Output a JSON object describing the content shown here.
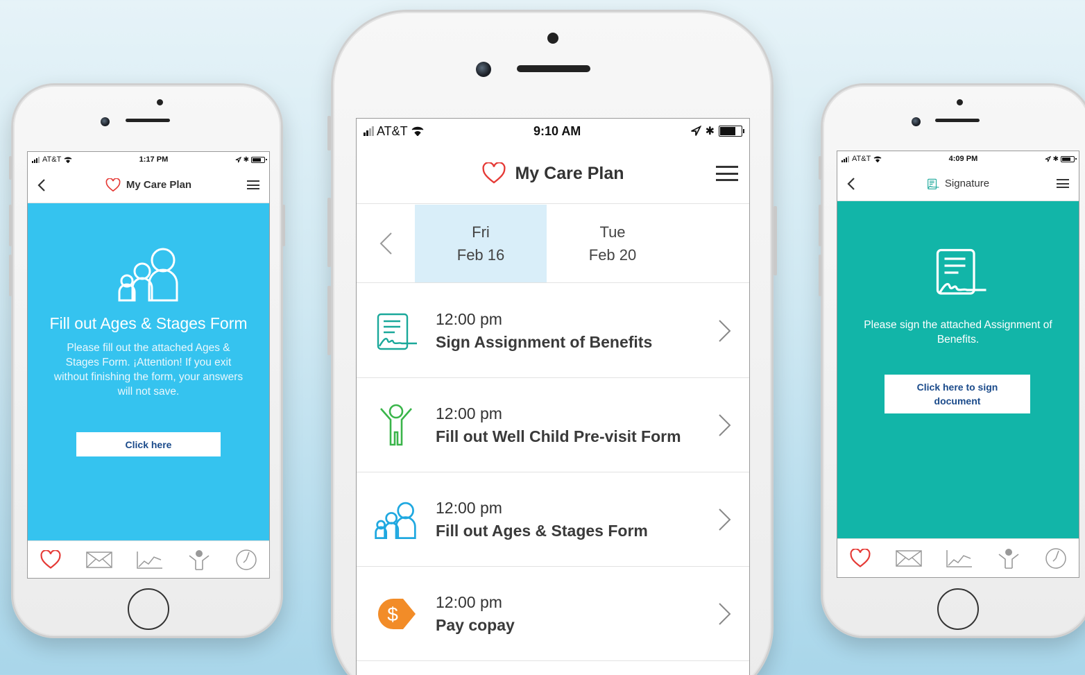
{
  "left_phone": {
    "status": {
      "carrier": "AT&T",
      "time": "1:17 PM"
    },
    "nav": {
      "title": "My Care Plan"
    },
    "content": {
      "heading": "Fill out Ages & Stages Form",
      "body": "Please fill out the attached Ages & Stages Form. ¡Attention! If you exit without finishing the form, your answers will not save.",
      "button": "Click here"
    },
    "tabs": [
      "heart-icon",
      "mail-icon",
      "chart-icon",
      "child-icon",
      "clock-icon"
    ]
  },
  "center_phone": {
    "status": {
      "carrier": "AT&T",
      "time": "9:10 AM"
    },
    "nav": {
      "title": "My Care Plan"
    },
    "dates": [
      {
        "weekday": "Fri",
        "date": "Feb 16",
        "selected": true
      },
      {
        "weekday": "Tue",
        "date": "Feb 20",
        "selected": false
      }
    ],
    "tasks": [
      {
        "time": "12:00 pm",
        "title": "Sign Assignment of Benefits",
        "icon": "signature-document-icon"
      },
      {
        "time": "12:00 pm",
        "title": "Fill out Well Child Pre-visit Form",
        "icon": "child-icon"
      },
      {
        "time": "12:00 pm",
        "title": "Fill out Ages & Stages Form",
        "icon": "family-icon"
      },
      {
        "time": "12:00 pm",
        "title": "Pay copay",
        "icon": "dollar-tag-icon"
      }
    ]
  },
  "right_phone": {
    "status": {
      "carrier": "AT&T",
      "time": "4:09 PM"
    },
    "nav": {
      "title": "Signature"
    },
    "content": {
      "body": "Please sign the attached Assignment of Benefits.",
      "button": "Click here to sign document"
    },
    "tabs": [
      "heart-icon",
      "mail-icon",
      "chart-icon",
      "child-icon",
      "clock-icon"
    ]
  },
  "colors": {
    "blue_panel": "#35c3ef",
    "teal_panel": "#12b5a8",
    "heart_red": "#e53935",
    "selected_date": "#d9eef9",
    "signature_green": "#1aa89a",
    "child_green": "#3ab54a",
    "family_blue": "#1fa8e0",
    "copay_orange": "#f28c28"
  }
}
